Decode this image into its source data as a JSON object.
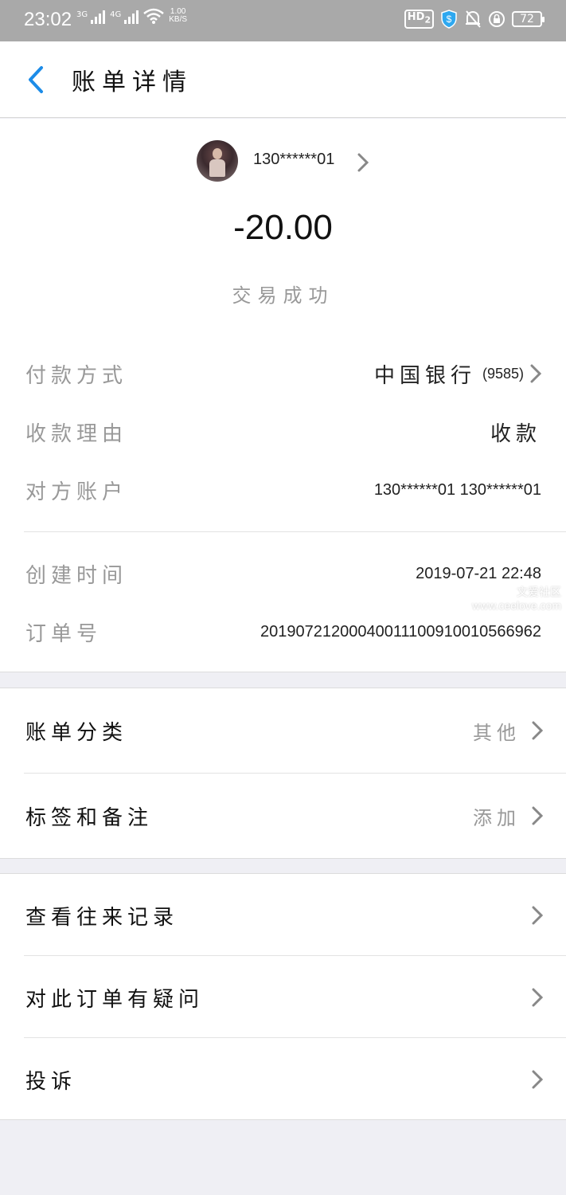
{
  "status_bar": {
    "time": "23:02",
    "net1": "3G",
    "net2": "4G",
    "speed_value": "1.00",
    "speed_unit": "KB/S",
    "hd": "HD",
    "hd_sub": "2",
    "battery": "72"
  },
  "nav": {
    "title": "账单详情"
  },
  "summary": {
    "payee": "130******01",
    "amount": "-20.00",
    "status": "交易成功"
  },
  "details": {
    "payment_method_label": "付款方式",
    "payment_method_bank": "中国银行",
    "payment_method_card": "(9585)",
    "reason_label": "收款理由",
    "reason_value": "收款",
    "account_label": "对方账户",
    "account_value": "130******01 130******01",
    "created_label": "创建时间",
    "created_value": "2019-07-21 22:48",
    "order_label": "订单号",
    "order_value": "20190721200040011100910010566962"
  },
  "watermark": {
    "line1": "文爱社区",
    "line2": "www.ceelove.com"
  },
  "menu1": {
    "category_label": "账单分类",
    "category_value": "其他",
    "tags_label": "标签和备注",
    "tags_value": "添加"
  },
  "menu2": {
    "history_label": "查看往来记录",
    "question_label": "对此订单有疑问",
    "complaint_label": "投诉"
  },
  "colors": {
    "accent": "#1c8ce8",
    "status_bar": "#a9a9a9",
    "background": "#efeff4"
  }
}
